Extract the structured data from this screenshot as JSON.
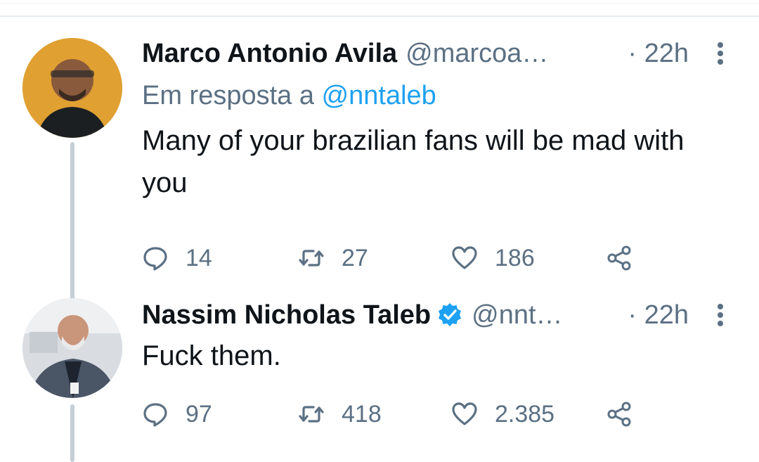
{
  "tweets": [
    {
      "name": "Marco Antonio Avila",
      "handle": "@marcoa…",
      "time": "· 22h",
      "reply_to_prefix": "Em resposta a",
      "reply_to_mention": "@nntaleb",
      "text": "Many of your brazilian fans will be mad with you",
      "counts": {
        "replies": "14",
        "retweets": "27",
        "likes": "186"
      },
      "verified": false
    },
    {
      "name": "Nassim Nicholas Taleb",
      "handle": "@nnt…",
      "time": "· 22h",
      "text": "Fuck them.",
      "counts": {
        "replies": "97",
        "retweets": "418",
        "likes": "2.385"
      },
      "verified": true
    }
  ],
  "icons": {
    "reply": "reply-icon",
    "retweet": "retweet-icon",
    "like": "heart-icon",
    "share": "share-icon",
    "more": "more-vertical-icon",
    "verified": "verified-badge-icon"
  },
  "colors": {
    "text_primary": "#0f1419",
    "text_secondary": "#5b7083",
    "link": "#1da1f2",
    "thread_line": "#c4cfd6"
  }
}
